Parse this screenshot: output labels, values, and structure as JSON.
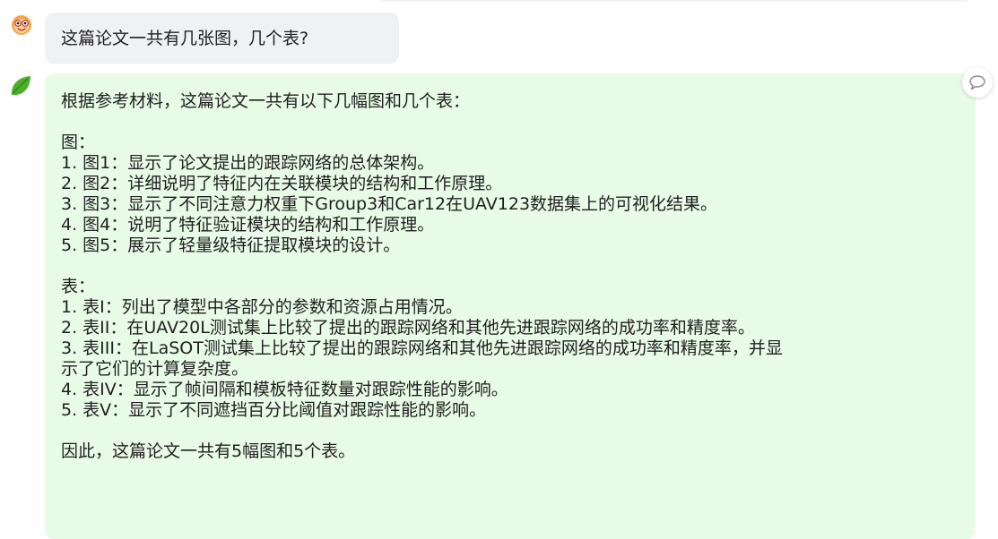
{
  "user_message": {
    "text": "这篇论文一共有几张图，几个表?"
  },
  "bot_message": {
    "intro": "根据参考材料，这篇论文一共有以下几幅图和几个表：",
    "figures_heading": "图：",
    "figures": [
      "1. 图1：显示了论文提出的跟踪网络的总体架构。",
      "2. 图2：详细说明了特征内在关联模块的结构和工作原理。",
      "3. 图3：显示了不同注意力权重下Group3和Car12在UAV123数据集上的可视化结果。",
      "4. 图4：说明了特征验证模块的结构和工作原理。",
      "5. 图5：展示了轻量级特征提取模块的设计。"
    ],
    "tables_heading": "表：",
    "tables": [
      "1. 表I：列出了模型中各部分的参数和资源占用情况。",
      "2. 表II：在UAV20L测试集上比较了提出的跟踪网络和其他先进跟踪网络的成功率和精度率。",
      "3. 表III：在LaSOT测试集上比较了提出的跟踪网络和其他先进跟踪网络的成功率和精度率，并显",
      "示了它们的计算复杂度。",
      "4. 表IV：显示了帧间隔和模板特征数量对跟踪性能的影响。",
      "5. 表V：显示了不同遮挡百分比阈值对跟踪性能的影响。"
    ],
    "summary_partial": "因此，这篇论文一共有5幅图和5个表。"
  },
  "icons": {
    "user_avatar": "smiley-face-icon",
    "bot_avatar": "green-leaf-icon",
    "copy": "speech-bubble-icon"
  },
  "colors": {
    "user_bubble": "#f0f1f3",
    "bot_bubble": "#e8fbe6",
    "leaf": "#4caf2a",
    "avatar_face": "#f5a64a"
  }
}
